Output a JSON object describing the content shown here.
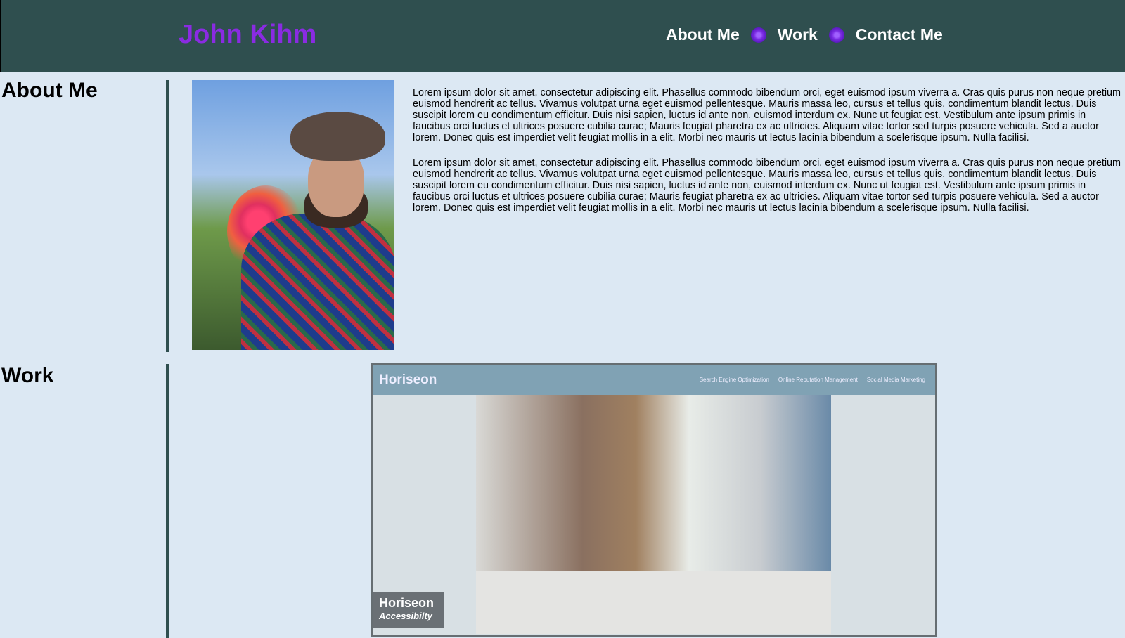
{
  "header": {
    "logo": "John Kihm",
    "nav": [
      "About Me",
      "Work",
      "Contact Me"
    ],
    "separator_icon": "spiral-icon"
  },
  "about": {
    "title": "About Me",
    "photo_alt": "Photo of John Kihm holding flowers",
    "paragraphs": [
      "Lorem ipsum dolor sit amet, consectetur adipiscing elit. Phasellus commodo bibendum orci, eget euismod ipsum viverra a. Cras quis purus non neque pretium euismod hendrerit ac tellus. Vivamus volutpat urna eget euismod pellentesque. Mauris massa leo, cursus et tellus quis, condimentum blandit lectus. Duis suscipit lorem eu condimentum efficitur. Duis nisi sapien, luctus id ante non, euismod interdum ex. Nunc ut feugiat est. Vestibulum ante ipsum primis in faucibus orci luctus et ultrices posuere cubilia curae; Mauris feugiat pharetra ex ac ultricies. Aliquam vitae tortor sed turpis posuere vehicula. Sed a auctor lorem. Donec quis est imperdiet velit feugiat mollis in a elit. Morbi nec mauris ut lectus lacinia bibendum a scelerisque ipsum. Nulla facilisi.",
      "Lorem ipsum dolor sit amet, consectetur adipiscing elit. Phasellus commodo bibendum orci, eget euismod ipsum viverra a. Cras quis purus non neque pretium euismod hendrerit ac tellus. Vivamus volutpat urna eget euismod pellentesque. Mauris massa leo, cursus et tellus quis, condimentum blandit lectus. Duis suscipit lorem eu condimentum efficitur. Duis nisi sapien, luctus id ante non, euismod interdum ex. Nunc ut feugiat est. Vestibulum ante ipsum primis in faucibus orci luctus et ultrices posuere cubilia curae; Mauris feugiat pharetra ex ac ultricies. Aliquam vitae tortor sed turpis posuere vehicula. Sed a auctor lorem. Donec quis est imperdiet velit feugiat mollis in a elit. Morbi nec mauris ut lectus lacinia bibendum a scelerisque ipsum. Nulla facilisi."
    ]
  },
  "work": {
    "title": "Work",
    "project": {
      "site_logo": "Horiseon",
      "site_nav": [
        "Search Engine Optimization",
        "Online Reputation Management",
        "Social Media Marketing"
      ],
      "badge_title": "Horiseon",
      "badge_subtitle": "Accessibilty"
    }
  },
  "colors": {
    "header_bg": "#2f4f4f",
    "logo": "#8a2be2",
    "page_bg": "#dce8f3"
  }
}
